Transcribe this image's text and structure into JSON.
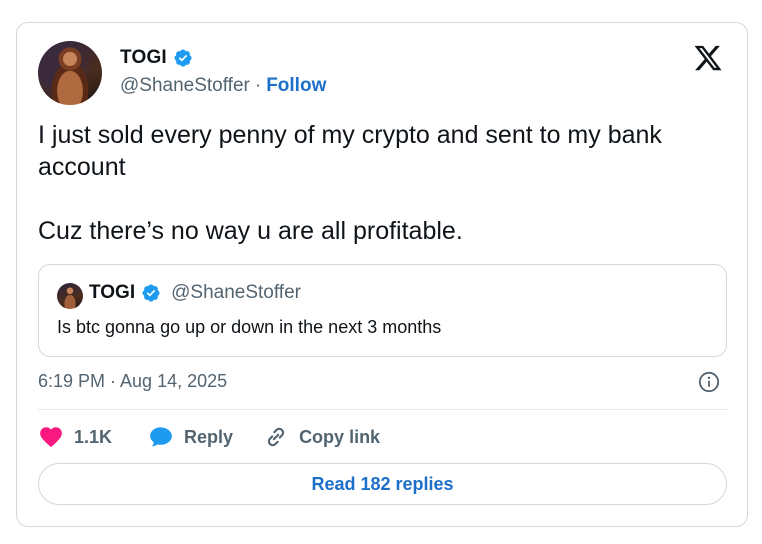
{
  "author": {
    "display_name": "TOGI",
    "handle": "@ShaneStoffer",
    "separator": "·",
    "follow_label": "Follow"
  },
  "tweet": {
    "text": "I just sold every penny of my crypto and sent to my bank account\n\nCuz there’s no way u are all profitable.",
    "timestamp": "6:19 PM · Aug 14, 2025"
  },
  "quoted_tweet": {
    "display_name": "TOGI",
    "handle": "@ShaneStoffer",
    "text": "Is btc gonna go up or down in the next 3 months"
  },
  "actions": {
    "likes": "1.1K",
    "reply_label": "Reply",
    "copy_link_label": "Copy link"
  },
  "read_replies_label": "Read 182 replies",
  "icons": {
    "logo": "x-logo-icon",
    "verified": "verified-badge-icon",
    "info": "info-icon",
    "like": "heart-icon",
    "reply": "speech-bubble-icon",
    "link": "link-icon"
  },
  "colors": {
    "link_blue": "#1d6fc9",
    "verified_blue": "#1d9bf0",
    "heart_pink": "#f91880",
    "secondary_text": "#536471",
    "border": "#cfd9de"
  }
}
